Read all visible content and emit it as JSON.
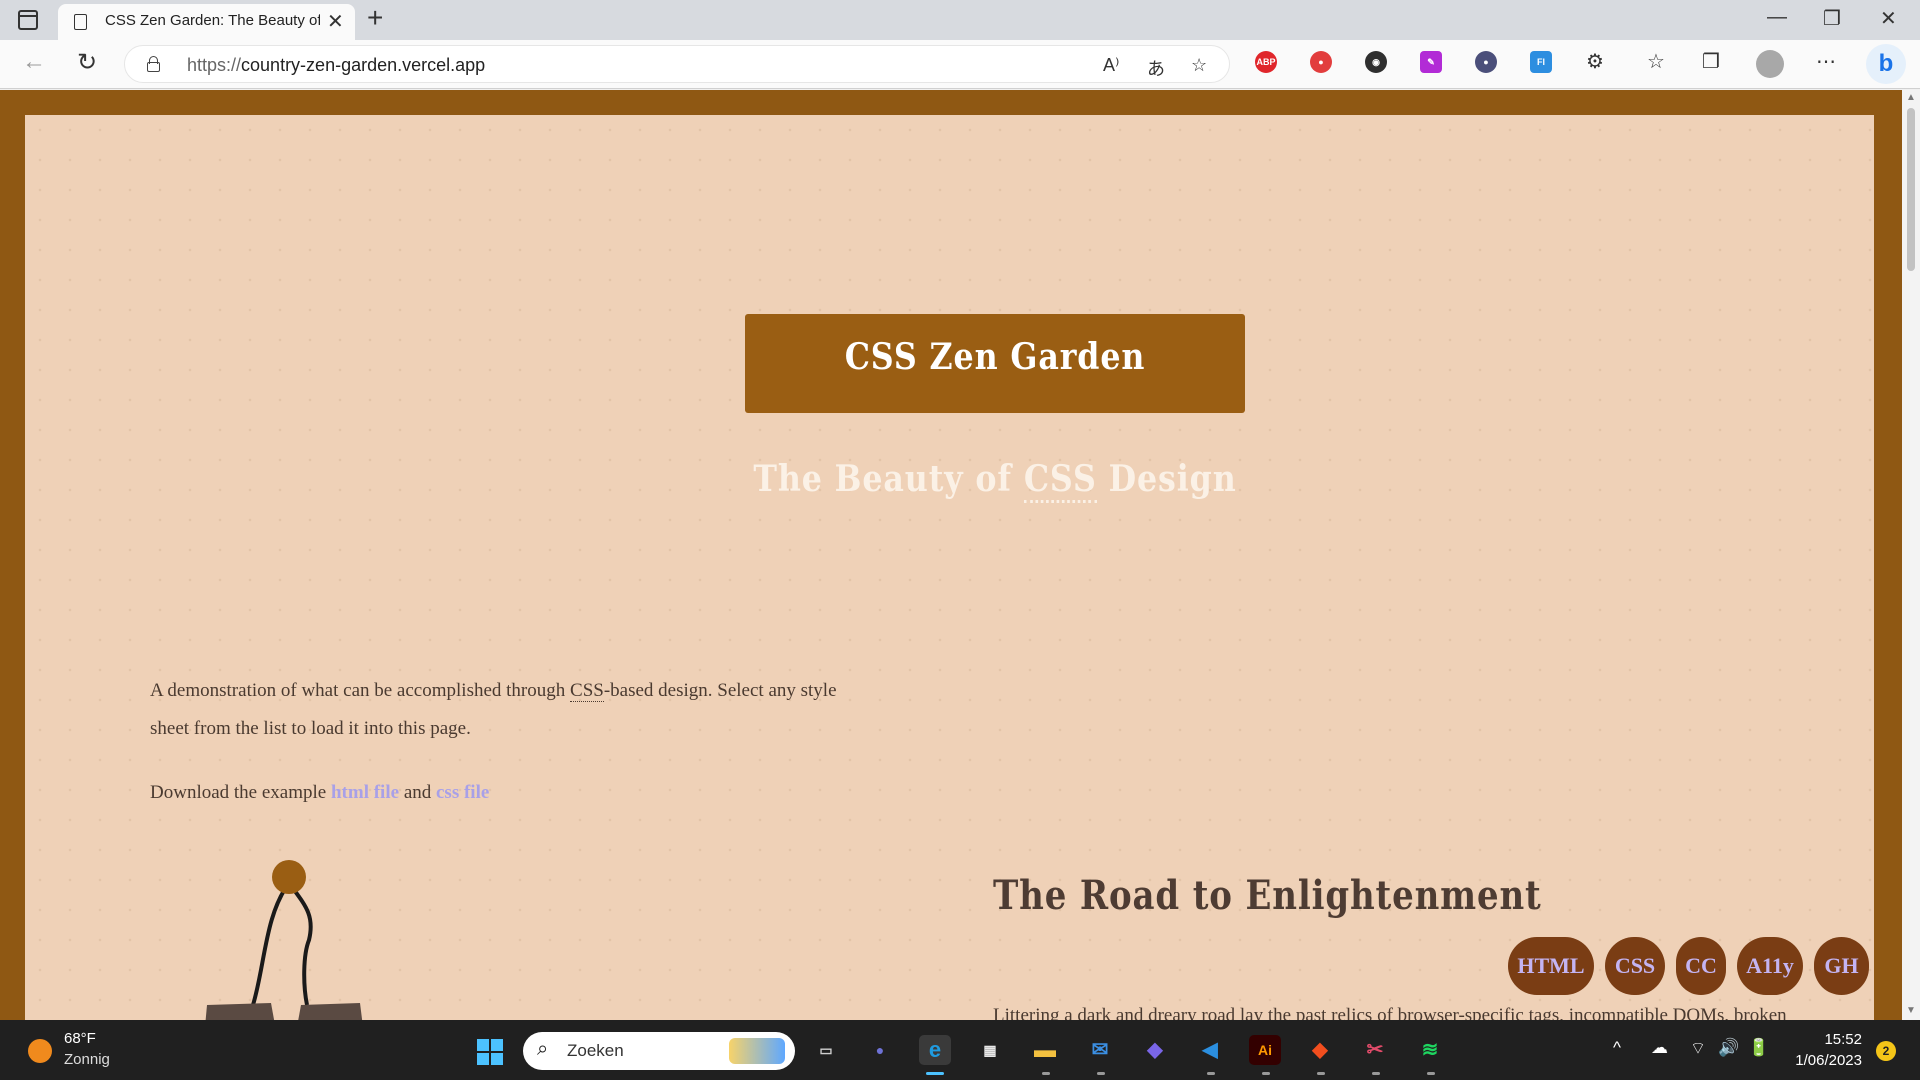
{
  "browser": {
    "tab_title": "CSS Zen Garden: The Beauty of CSS Design",
    "new_tab_glyph": "+",
    "window_controls": [
      "—",
      "❐",
      "✕"
    ],
    "url_protocol": "https://",
    "url_host": "country-zen-garden.vercel.app",
    "icons": [
      "vertical-tabs-icon",
      "page-icon",
      "close-icon",
      "back-icon",
      "refresh-icon",
      "lock-icon",
      "read-aloud-icon",
      "translate-icon",
      "add-favorite-icon",
      "adblock-plus-icon",
      "record-icon",
      "color-picker-icon",
      "extension-icon",
      "theme-icon",
      "fl-extension-icon",
      "extensions-icon",
      "favorites-icon",
      "collections-icon",
      "profile-icon",
      "more-icon",
      "bing-icon"
    ],
    "extensions": [
      {
        "label": "ABP",
        "color": "#e0262b"
      },
      {
        "label": "●",
        "color": "#e23d3d"
      },
      {
        "label": "◉",
        "color": "#2f2f2f"
      },
      {
        "label": "✎",
        "color": "#b22bd6"
      },
      {
        "label": "●",
        "color": "#4b4f7a"
      },
      {
        "label": "Fl",
        "color": "#2d8ee0"
      }
    ],
    "bing_label": "b"
  },
  "page": {
    "title": "CSS Zen Garden",
    "subtitle_pre": "The Beauty of ",
    "subtitle_abbr": "CSS",
    "subtitle_post": " Design",
    "intro_pre": "A demonstration of what can be accomplished through ",
    "intro_abbr": "CSS",
    "intro_post": "-based design. Select any style sheet from the list to load it into this page.",
    "download_pre": "Download the example ",
    "download_html": "html file",
    "download_and": " and ",
    "download_css": "css file",
    "road_title": "The Road to Enlightenment",
    "road_text": "Littering a dark and dreary road lay the past relics of browser-specific tags, incompatible DOMs, broken",
    "badges": [
      "HTML",
      "CSS",
      "CC",
      "A11y",
      "GH"
    ],
    "colors": {
      "frame": "#8f5813",
      "page_bg": "#efd1b7",
      "title_box": "#9a5e13",
      "badge": "#7a3d14",
      "link": "#a8a0e8"
    }
  },
  "taskbar": {
    "weather_temp": "68°F",
    "weather_condition": "Zonnig",
    "search_placeholder": "Zoeken",
    "apps": [
      {
        "name": "task-view",
        "glyph": "▭",
        "color": "#cfcfcf"
      },
      {
        "name": "teams-chat",
        "glyph": "●",
        "color": "#6e72d6"
      },
      {
        "name": "edge",
        "glyph": "e",
        "color": "#1f9be0"
      },
      {
        "name": "store",
        "glyph": "▦",
        "color": "#e8e8e8"
      },
      {
        "name": "file-explorer",
        "glyph": "▬",
        "color": "#f3c140"
      },
      {
        "name": "mail",
        "glyph": "✉",
        "color": "#3b8fe3"
      },
      {
        "name": "copilot",
        "glyph": "◆",
        "color": "#7a66e8"
      },
      {
        "name": "vscode",
        "glyph": "◀",
        "color": "#2b8fe0"
      },
      {
        "name": "illustrator",
        "glyph": "Ai",
        "color": "#ff9a00"
      },
      {
        "name": "figma",
        "glyph": "◆",
        "color": "#f24e1e"
      },
      {
        "name": "snipping-tool",
        "glyph": "✂",
        "color": "#e24b6a"
      },
      {
        "name": "spotify",
        "glyph": "≋",
        "color": "#1ed760"
      }
    ],
    "tray": [
      "^",
      "☁",
      "wifi",
      "🔊",
      "🔋"
    ],
    "time": "15:52",
    "date": "1/06/2023",
    "notifications": "2"
  }
}
